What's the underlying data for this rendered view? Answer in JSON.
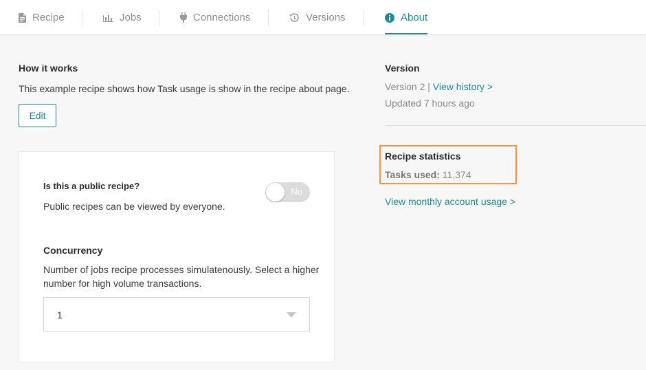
{
  "tabs": [
    {
      "label": "Recipe",
      "icon": "document-icon",
      "active": false
    },
    {
      "label": "Jobs",
      "icon": "bar-chart-icon",
      "active": false
    },
    {
      "label": "Connections",
      "icon": "plug-icon",
      "active": false
    },
    {
      "label": "Versions",
      "icon": "history-icon",
      "active": false
    },
    {
      "label": "About",
      "icon": "info-icon",
      "active": true
    }
  ],
  "how_it_works": {
    "title": "How it works",
    "description": "This example recipe shows how Task usage is show in the recipe about page.",
    "edit_label": "Edit"
  },
  "settings": {
    "public_title": "Is this a public recipe?",
    "public_desc": "Public recipes can be viewed by everyone.",
    "public_toggle_label": "No",
    "concurrency_title": "Concurrency",
    "concurrency_desc_line1": "Number of jobs recipe processes simulatenously. Select a higher",
    "concurrency_desc_line2": "number for high volume transactions.",
    "concurrency_value": "1"
  },
  "version": {
    "title": "Version",
    "version_text": "Version 2 |",
    "history_link": "View history >",
    "updated": "Updated 7 hours ago"
  },
  "stats": {
    "title": "Recipe statistics",
    "tasks_label": "Tasks used:",
    "tasks_value": "11,374",
    "usage_link": "View monthly account usage >"
  },
  "colors": {
    "accent": "#1d8b92",
    "highlight": "#f3943a",
    "muted_text": "#8a8a8a"
  }
}
